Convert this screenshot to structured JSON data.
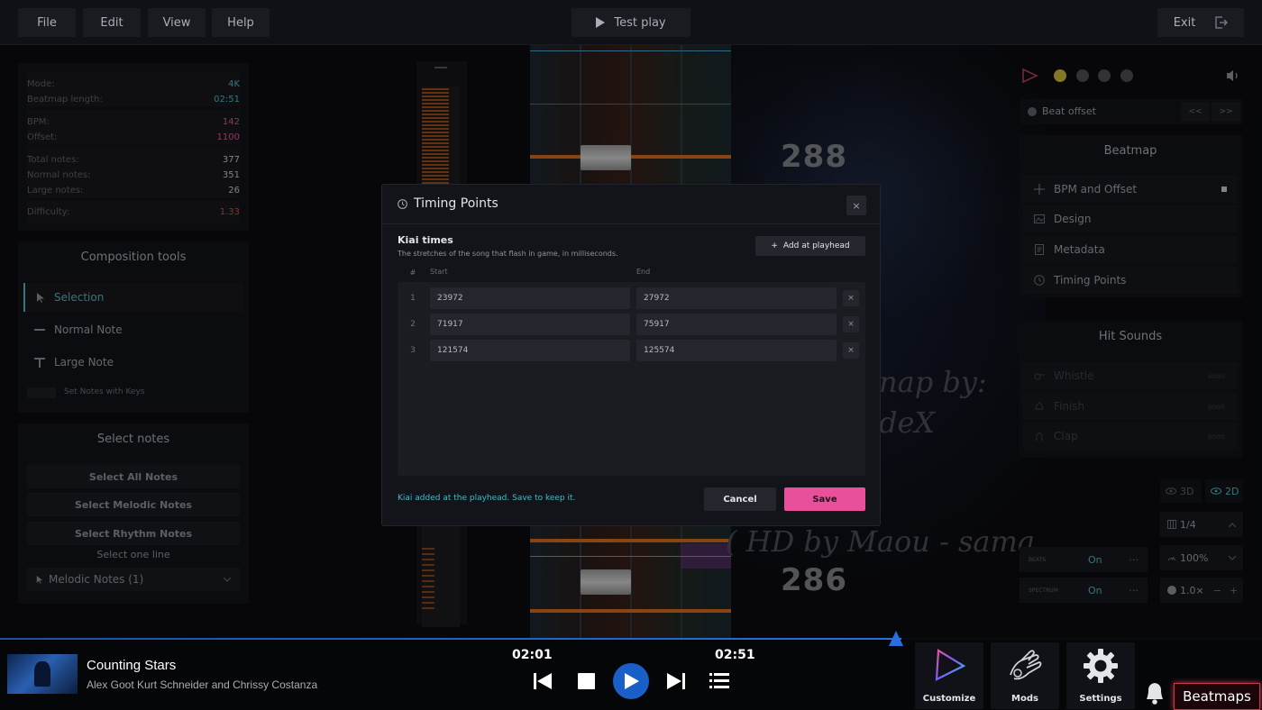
{
  "menu": {
    "file": "File",
    "edit": "Edit",
    "view": "View",
    "help": "Help",
    "test_play": "Test play",
    "exit": "Exit"
  },
  "stats": {
    "mode_k": "Mode:",
    "mode_v": "4K",
    "length_k": "Beatmap length:",
    "length_v": "02:51",
    "bpm_k": "BPM:",
    "bpm_v": "142",
    "offset_k": "Offset:",
    "offset_v": "1100",
    "total_k": "Total notes:",
    "total_v": "377",
    "normal_k": "Normal notes:",
    "normal_v": "351",
    "large_k": "Large notes:",
    "large_v": "26",
    "difficulty_k": "Difficulty:",
    "difficulty_v": "1.33"
  },
  "composition": {
    "title": "Composition tools",
    "selection": "Selection",
    "normal_note": "Normal Note",
    "large_note": "Large Note",
    "set_notes_keys": "Set Notes with Keys"
  },
  "select_notes": {
    "title": "Select notes",
    "all": "Select All Notes",
    "melodic": "Select Melodic Notes",
    "rhythm": "Select Rhythm Notes",
    "one_line": "Select one line",
    "dropdown": "Melodic Notes (1)"
  },
  "background": {
    "combo_top": "288",
    "combo_bottom": "286",
    "script_1": "nap by:",
    "script_2": "deX",
    "script_3": "( HD by Maou - sama"
  },
  "right": {
    "beat_offset": "Beat offset",
    "prev": "<<",
    "next": ">>",
    "beatmap_title": "Beatmap",
    "bpm_offset": "BPM and Offset",
    "design": "Design",
    "metadata": "Metadata",
    "timing_points": "Timing Points",
    "hit_sounds_title": "Hit Sounds",
    "whistle": "Whistle",
    "finish": "Finish",
    "clap": "Clap",
    "soon": "soon",
    "view_3d": "3D",
    "view_2d": "2D",
    "snap": "1/4",
    "beats_label": "BEATS",
    "beats_val": "On",
    "spectrum_label": "SPECTRUM",
    "spectrum_val": "On",
    "speed": "100%",
    "zoom": "1.0×",
    "minus": "−",
    "plus": "+",
    "more": "···"
  },
  "modal": {
    "title": "Timing Points",
    "close": "×",
    "section_title": "Kiai times",
    "section_desc": "The stretches of the song that flash in game, in milliseconds.",
    "add_button": "Add at playhead",
    "col_index": "#",
    "col_start": "Start",
    "col_end": "End",
    "rows": [
      {
        "index": "1",
        "start": "23972",
        "end": "27972"
      },
      {
        "index": "2",
        "start": "71917",
        "end": "75917"
      },
      {
        "index": "3",
        "start": "121574",
        "end": "125574"
      }
    ],
    "status": "Kiai added at the playhead. Save to keep it.",
    "cancel": "Cancel",
    "save": "Save"
  },
  "player": {
    "song_title": "Counting Stars",
    "artists": "Alex Goot Kurt Schneider and Chrissy Costanza",
    "current_time": "02:01",
    "total_time": "02:51",
    "customize": "Customize",
    "mods": "Mods",
    "settings": "Settings",
    "beatmaps": "Beatmaps"
  },
  "colors": {
    "accent_pink": "#e8509c",
    "accent_teal": "#4fb6c0",
    "lane_orange": "#d26a1e",
    "difficulty_red": "#d04848",
    "bpm_pink": "#d6569a",
    "dot_yellow": "#c9b63a"
  }
}
